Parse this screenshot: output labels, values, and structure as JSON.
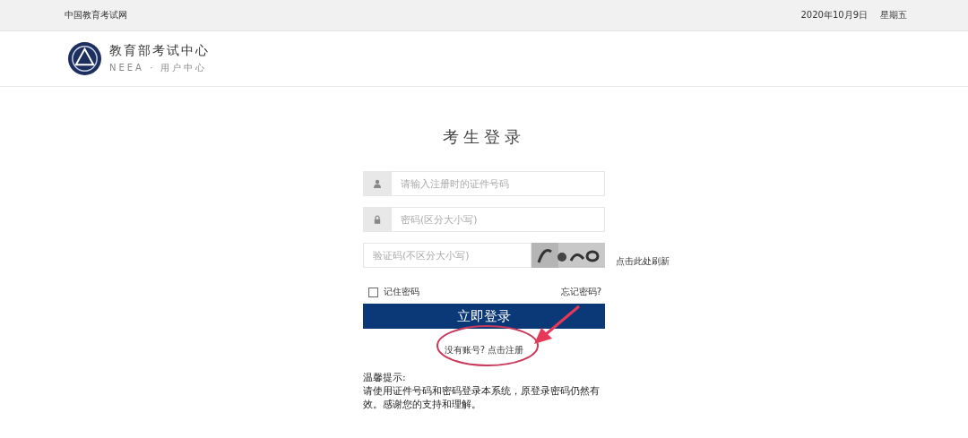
{
  "top_bar": {
    "site": "中国教育考试网",
    "date": "2020年10月9日",
    "weekday": "星期五"
  },
  "header": {
    "name": "教育部考试中心",
    "subtitle": "NEEA · 用户中心"
  },
  "login": {
    "title": "考生登录",
    "fields": [
      {
        "kind": "user",
        "placeholder": "请输入注册时的证件号码"
      },
      {
        "kind": "lock",
        "placeholder": "密码(区分大小写)"
      }
    ],
    "captcha": {
      "placeholder": "验证码(不区分大小写)",
      "refresh": "点击此处刷新"
    },
    "remember": {
      "label": "记住密码",
      "checked": false
    },
    "forgot": "忘记密码?",
    "submit": "立即登录",
    "register": "没有账号? 点击注册",
    "tips_title": "温馨提示:",
    "tips": "请使用证件号码和密码登录本系统，原登录密码仍然有效。感谢您的支持和理解。"
  }
}
